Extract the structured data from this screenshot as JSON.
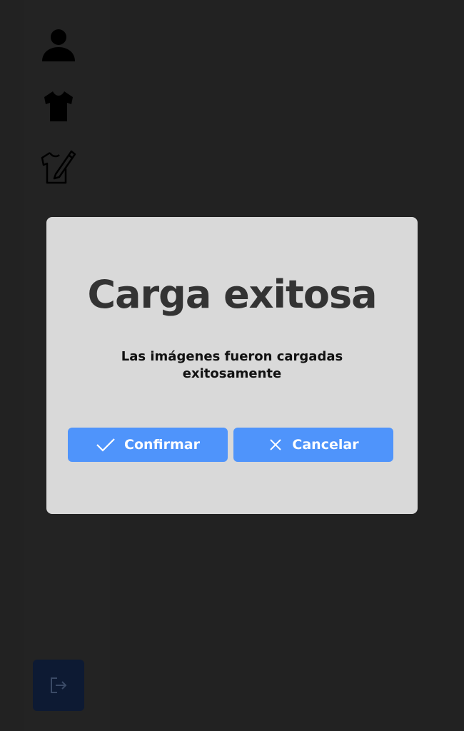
{
  "sidebar": {
    "items": [
      {
        "icon": "user-icon"
      },
      {
        "icon": "tshirt-icon"
      },
      {
        "icon": "tshirt-design-icon"
      }
    ],
    "logout": {
      "icon": "logout-icon"
    }
  },
  "modal": {
    "title": "Carga exitosa",
    "message": "Las imágenes fueron cargadas exitosamente",
    "confirm_label": "Confirmar",
    "confirm_icon": "check-icon",
    "cancel_label": "Cancelar",
    "cancel_icon": "close-icon"
  },
  "colors": {
    "background": "#222222",
    "modal_background": "#d9d9d9",
    "button_blue": "#4f94fb",
    "logout_background": "#0d1a33"
  }
}
